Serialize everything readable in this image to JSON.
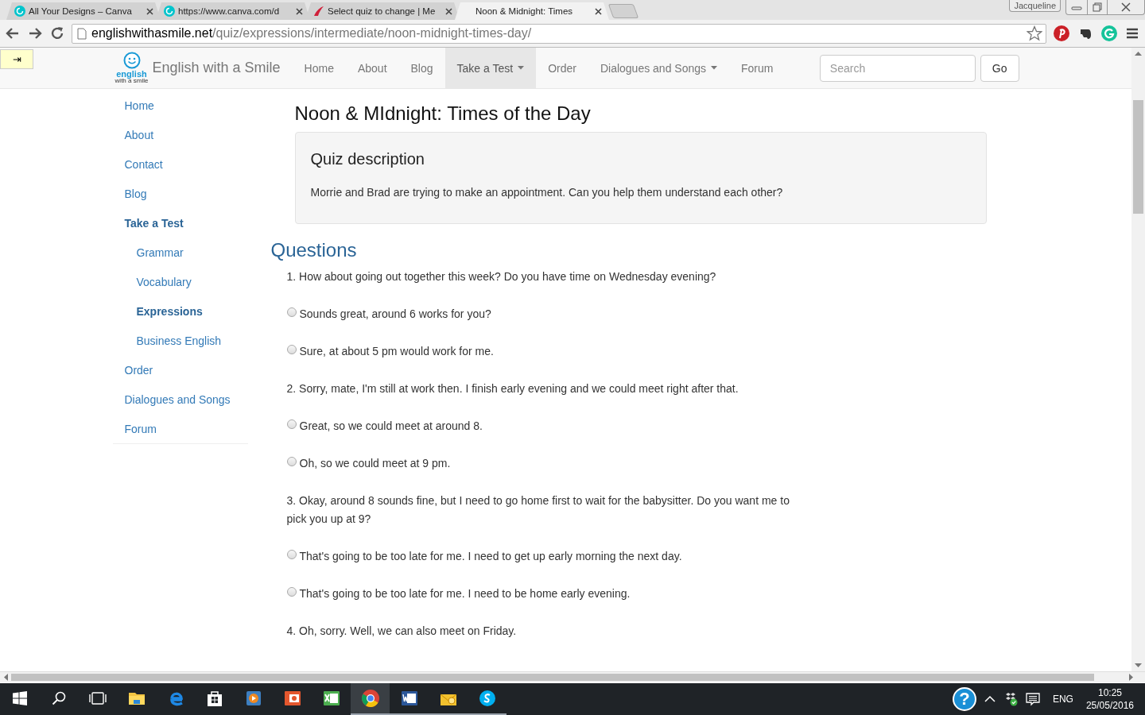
{
  "browser": {
    "tabs": [
      {
        "title": "All Your Designs – Canva",
        "kind": "circle",
        "selected": false
      },
      {
        "title": "https://www.canva.com/d",
        "kind": "circle",
        "selected": false
      },
      {
        "title": "Select quiz to change | Me",
        "kind": "swoosh",
        "selected": false
      },
      {
        "title": "Noon & Midnight: Times",
        "selected": true
      }
    ],
    "profile": "Jacqueline",
    "address": {
      "domain": "englishwithasmile.net",
      "path": "/quiz/expressions/intermediate/noon-midnight-times-day/"
    }
  },
  "sidebar_toggle": "⇥",
  "navbar": {
    "logo_word": "english",
    "logo_tagline": "with a smile",
    "brand": "English with a Smile",
    "items": [
      {
        "label": "Home",
        "selected": false,
        "dropdown": false
      },
      {
        "label": "About",
        "selected": false,
        "dropdown": false
      },
      {
        "label": "Blog",
        "selected": false,
        "dropdown": false
      },
      {
        "label": "Take a Test",
        "selected": true,
        "dropdown": true
      },
      {
        "label": "Order",
        "selected": false,
        "dropdown": false
      },
      {
        "label": "Dialogues and Songs",
        "selected": false,
        "dropdown": true
      },
      {
        "label": "Forum",
        "selected": false,
        "dropdown": false
      }
    ],
    "search": {
      "placeholder": "Search"
    },
    "button": "Go"
  },
  "sidebar": {
    "items": [
      {
        "label": "Home",
        "selected": false
      },
      {
        "label": "About",
        "selected": false
      },
      {
        "label": "Contact",
        "selected": false
      },
      {
        "label": "Blog",
        "selected": false
      },
      {
        "label": "Take a Test",
        "selected": true,
        "children": [
          {
            "label": "Grammar",
            "selected": false
          },
          {
            "label": "Vocabulary",
            "selected": false
          },
          {
            "label": "Expressions",
            "selected": true
          },
          {
            "label": "Business English",
            "selected": false
          }
        ]
      },
      {
        "label": "Order",
        "selected": false
      },
      {
        "label": "Dialogues and Songs",
        "selected": false
      },
      {
        "label": "Forum",
        "selected": false
      }
    ]
  },
  "page": {
    "title": "Noon & MIdnight: Times of the Day",
    "description": {
      "heading": "Quiz description",
      "text": "Morrie and Brad are trying to make an appointment. Can you help them understand each other?"
    }
  },
  "questions": {
    "heading": "Questions",
    "items": [
      {
        "text": "1. How about going out together this week? Do you have time on Wednesday evening?",
        "options": [
          {
            "text": "Sounds great, around 6 works for you?",
            "selected": false
          },
          {
            "text": "Sure, at about 5 pm would work for me.",
            "selected": false
          }
        ]
      },
      {
        "text": "2. Sorry, mate, I'm still at work then. I finish early evening and we could meet right after that.",
        "options": [
          {
            "text": "Great, so we could meet at around 8.",
            "selected": false
          },
          {
            "text": "Oh, so we could meet at 9 pm.",
            "selected": false
          }
        ]
      },
      {
        "text": "3. Okay, around 8 sounds fine, but I need to go home first to wait for the babysitter. Do you want me to pick you up at 9?",
        "options": [
          {
            "text": "That's going to be too late for me. I need to get up early morning the next day.",
            "selected": false
          },
          {
            "text": "That's going to be too late for me. I need to be home early evening.",
            "selected": false
          }
        ]
      },
      {
        "text": "4. Oh, sorry. Well, we can also meet on Friday."
      }
    ]
  },
  "taskbar": {
    "apps": [
      {
        "kind": "start",
        "running": false,
        "active": false
      },
      {
        "kind": "search",
        "running": false,
        "active": false
      },
      {
        "kind": "taskview",
        "running": false,
        "active": false
      },
      {
        "kind": "folder",
        "running": false,
        "active": false
      },
      {
        "kind": "edge",
        "running": false,
        "active": false
      },
      {
        "kind": "store",
        "running": false,
        "active": false
      },
      {
        "kind": "media",
        "running": false,
        "active": false
      },
      {
        "kind": "slides",
        "running": false,
        "active": false
      },
      {
        "kind": "sheet",
        "running": false,
        "active": false
      },
      {
        "kind": "browser",
        "running": true,
        "active": true
      },
      {
        "kind": "word",
        "running": true,
        "active": false
      },
      {
        "kind": "mail",
        "running": true,
        "active": false
      },
      {
        "kind": "chat",
        "running": true,
        "active": false
      }
    ],
    "tray": {
      "help": "?",
      "language": "ENG",
      "time": "10:25",
      "date": "25/05/2016"
    }
  }
}
